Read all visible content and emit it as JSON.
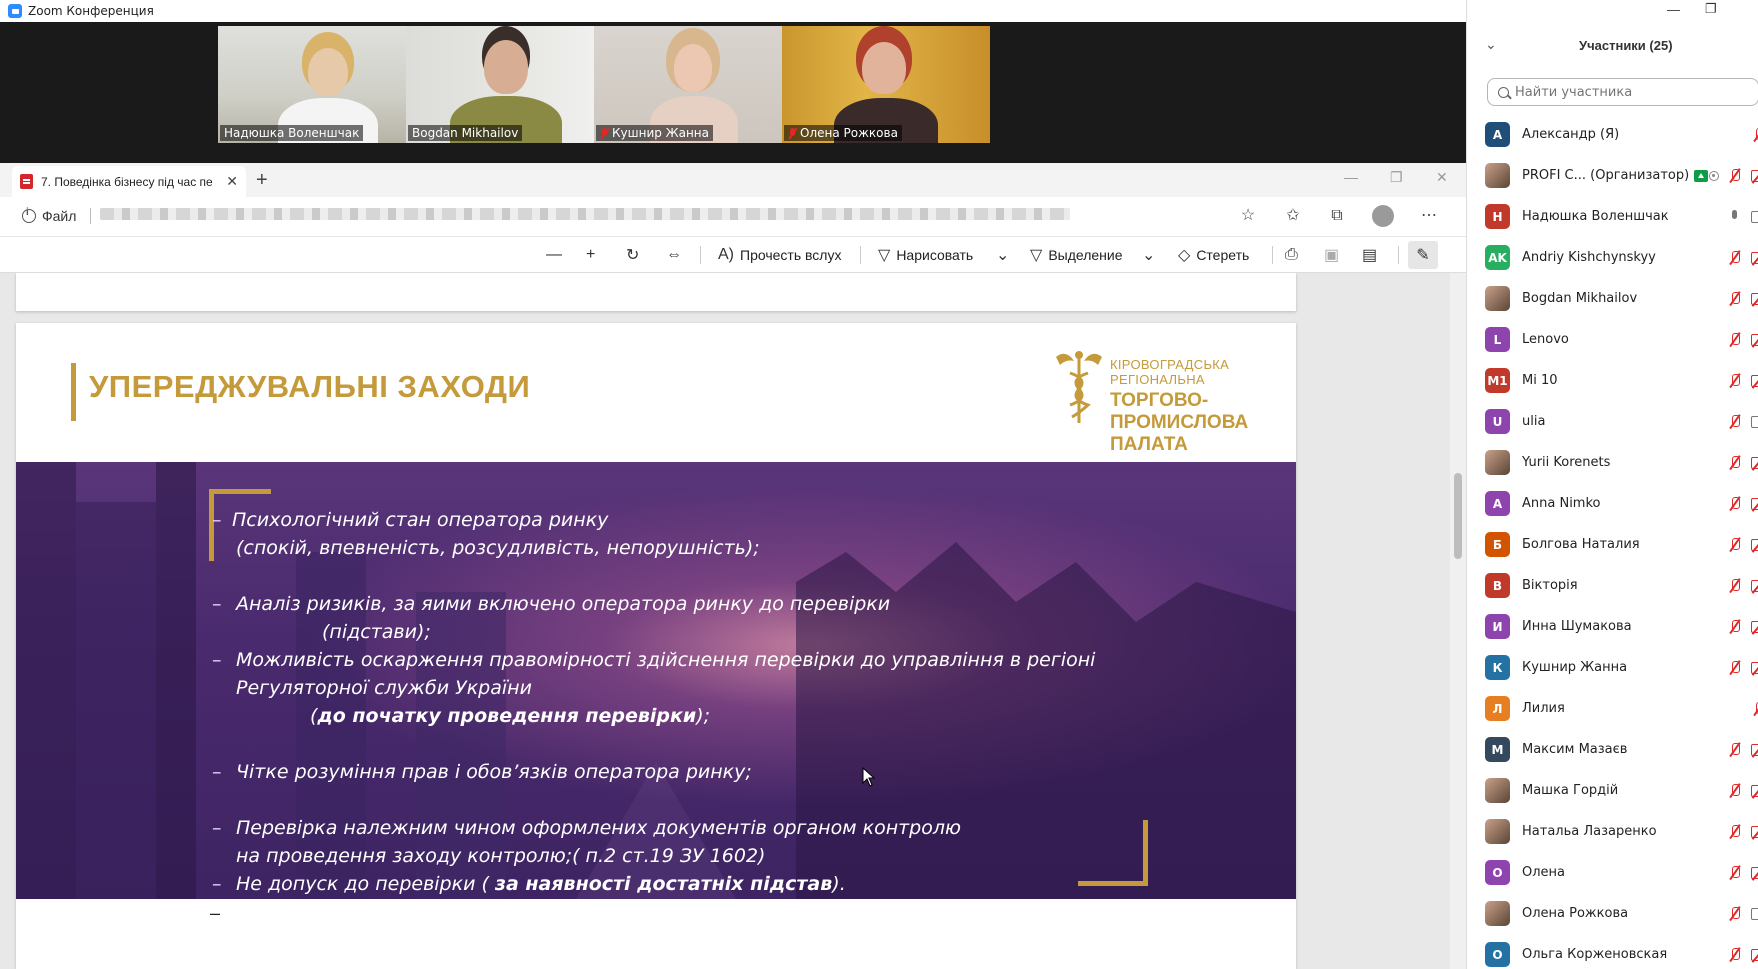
{
  "zoom": {
    "window_title": "Zoom Конференция",
    "videos": [
      {
        "name": "Надюшка Воленшчак",
        "muted": false,
        "active": true
      },
      {
        "name": "Bogdan Mikhailov",
        "muted": false,
        "active": false
      },
      {
        "name": "Кушнир Жанна",
        "muted": true,
        "active": false
      },
      {
        "name": "Олена Рожкова",
        "muted": true,
        "active": false
      }
    ]
  },
  "browser": {
    "tab_title": "7. Поведінка бізнесу під час пе",
    "address_label": "Файл",
    "toolbar": {
      "read_aloud": "Прочесть вслух",
      "draw": "Нарисовать",
      "highlight": "Выделение",
      "erase": "Стереть"
    }
  },
  "slide": {
    "title": "УПЕРЕДЖУВАЛЬНІ ЗАХОДИ",
    "logo": {
      "line1": "КІРОВОГРАДСЬКА РЕГІОНАЛЬНА",
      "line2": "ТОРГОВО-ПРОМИСЛОВА",
      "line3": "ПАЛАТА"
    },
    "bullets": {
      "b1_l1": "Психологічний стан оператора ринку",
      "b1_l2": "(спокій,  впевненість, розсудливість, непорушність);",
      "b2_l1": "Аналіз ризиків, за яими включено оператора ринку до перевірки",
      "b2_l2": "(підстави);",
      "b3_l1": "Можливість оскарження правомірності здійснення перевірки до управління в регіоні",
      "b3_l2": "Регуляторної служби України",
      "b3_l3_pre": "(",
      "b3_l3_bold": "до початку проведення перевірки",
      "b3_l3_post": ");",
      "b4_l1": "Чітке розуміння прав і обов’язків оператора ринку;",
      "b5_l1": "Перевірка належним чином оформлених документів органом контролю",
      "b5_l2": "на проведення заходу контролю;( п.2 ст.19 ЗУ 1602)",
      "b6_pre": "Не допуск до перевірки ( ",
      "b6_bold": "за наявності достатніх підстав",
      "b6_post": ").",
      "dash": "–"
    }
  },
  "participants": {
    "title": "Участники (25)",
    "search_placeholder": "Найти участника",
    "list": [
      {
        "initials": "А",
        "color": "#1f4e79",
        "name": "Александр (Я)",
        "icons": [
          "mic-off"
        ]
      },
      {
        "initials": "",
        "color": "photo",
        "name": "PROFI C... (Организатор)",
        "icons": [
          "rec",
          "mic-off",
          "cam-off"
        ],
        "host": true
      },
      {
        "initials": "Н",
        "color": "#c0392b",
        "name": "Надюшка Воленшчак",
        "icons": [
          "mic-on",
          "cam-on"
        ]
      },
      {
        "initials": "AK",
        "color": "#27ae60",
        "name": "Andriy Kishchynskyy",
        "icons": [
          "mic-off",
          "cam-off"
        ]
      },
      {
        "initials": "",
        "color": "photo",
        "name": "Bogdan Mikhailov",
        "icons": [
          "mic-off",
          "cam-off"
        ]
      },
      {
        "initials": "L",
        "color": "#8e44ad",
        "name": "Lenovo",
        "icons": [
          "mic-off",
          "cam-off"
        ]
      },
      {
        "initials": "M1",
        "color": "#c0392b",
        "name": "Mi 10",
        "icons": [
          "mic-off",
          "cam-off"
        ]
      },
      {
        "initials": "U",
        "color": "#8e44ad",
        "name": "ulia",
        "icons": [
          "mic-off",
          "cam-on"
        ]
      },
      {
        "initials": "",
        "color": "photo",
        "name": "Yurii Korenets",
        "icons": [
          "mic-off",
          "cam-off"
        ]
      },
      {
        "initials": "A",
        "color": "#8e44ad",
        "name": "Anna Nimko",
        "icons": [
          "mic-off",
          "cam-off"
        ]
      },
      {
        "initials": "Б",
        "color": "#d35400",
        "name": "Болгова Наталия",
        "icons": [
          "mic-off",
          "cam-off"
        ]
      },
      {
        "initials": "В",
        "color": "#c0392b",
        "name": "Вікторія",
        "icons": [
          "mic-off",
          "cam-off"
        ]
      },
      {
        "initials": "И",
        "color": "#8e44ad",
        "name": "Инна Шумакова",
        "icons": [
          "mic-off",
          "cam-off"
        ]
      },
      {
        "initials": "К",
        "color": "#2471a3",
        "name": "Кушнир Жанна",
        "icons": [
          "mic-off",
          "cam-off"
        ]
      },
      {
        "initials": "Л",
        "color": "#e67e22",
        "name": "Лилия",
        "icons": [
          "mic-off"
        ]
      },
      {
        "initials": "М",
        "color": "#34495e",
        "name": "Максим Мазаєв",
        "icons": [
          "mic-off",
          "cam-off"
        ]
      },
      {
        "initials": "",
        "color": "photo",
        "name": "Машка Гордій",
        "icons": [
          "mic-off",
          "cam-off"
        ]
      },
      {
        "initials": "",
        "color": "photo",
        "name": "Натальа Лазаренко",
        "icons": [
          "mic-off",
          "cam-off"
        ]
      },
      {
        "initials": "O",
        "color": "#8e44ad",
        "name": "Олена",
        "icons": [
          "mic-off",
          "cam-off"
        ]
      },
      {
        "initials": "",
        "color": "photo",
        "name": "Олена Рожкова",
        "icons": [
          "mic-off",
          "cam-on"
        ]
      },
      {
        "initials": "O",
        "color": "#2471a3",
        "name": "Ольга Корженовская",
        "icons": [
          "mic-off",
          "cam-off"
        ]
      }
    ]
  }
}
